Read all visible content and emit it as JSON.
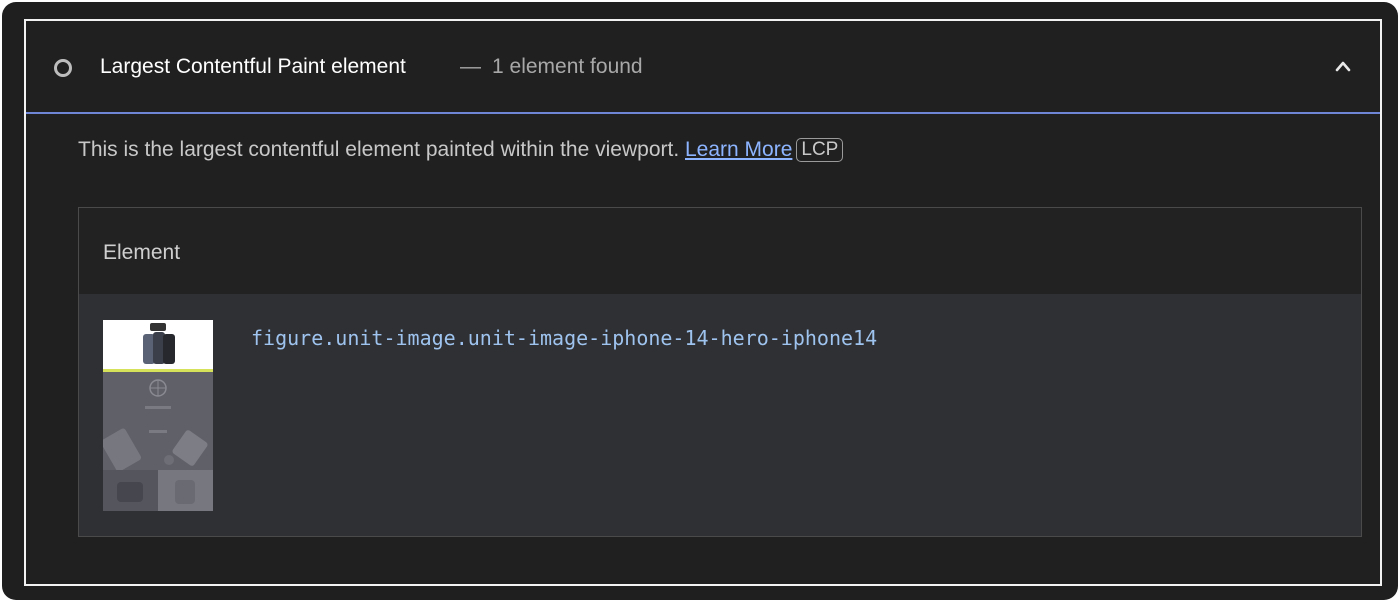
{
  "audit": {
    "title": "Largest Contentful Paint element",
    "separator": "—",
    "display_value": "1 element found",
    "status_icon": "circle-outline-icon",
    "toggle_icon": "chevron-up-icon",
    "accent_color": "#6f86d6"
  },
  "description": {
    "text": "This is the largest contentful element painted within the viewport.",
    "link_label": "Learn More",
    "badge": "LCP"
  },
  "table": {
    "columns": [
      "Element"
    ],
    "rows": [
      {
        "thumbnail": "page-screenshot-thumbnail",
        "node_path": "figure.unit-image.unit-image-iphone-14-hero-iphone14"
      }
    ]
  }
}
